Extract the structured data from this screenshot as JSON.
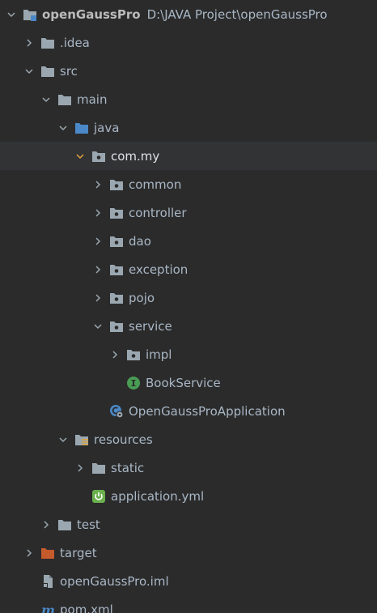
{
  "project": {
    "name": "openGaussPro",
    "path": "D:\\JAVA Project\\openGaussPro"
  },
  "nodes": {
    "idea": ".idea",
    "src": "src",
    "main": "main",
    "java": "java",
    "commy": "com.my",
    "common": "common",
    "controller": "controller",
    "dao": "dao",
    "exception": "exception",
    "pojo": "pojo",
    "service": "service",
    "impl": "impl",
    "bookservice": "BookService",
    "app": "OpenGaussProApplication",
    "resources": "resources",
    "static": "static",
    "appyml": "application.yml",
    "test": "test",
    "target": "target",
    "iml": "openGaussPro.iml",
    "pom": "pom.xml"
  },
  "icons": {
    "folder": "folder-icon",
    "package": "package-folder-icon",
    "source_root": "source-root-folder-icon",
    "resources_root": "resources-folder-icon",
    "excluded": "excluded-folder-icon",
    "interface": "interface-icon",
    "spring_boot_class": "spring-boot-class-icon",
    "spring_config": "spring-config-icon",
    "iml_file": "iml-file-icon",
    "maven": "maven-icon"
  },
  "colors": {
    "background": "#2b2b2b",
    "selection": "#313335",
    "folder": "#9aa7b0",
    "source_root": "#4a88c7",
    "excluded": "#c55a2c",
    "interface": "#499c54",
    "spring": "#6ab04c",
    "text": "#a9b7c6"
  }
}
